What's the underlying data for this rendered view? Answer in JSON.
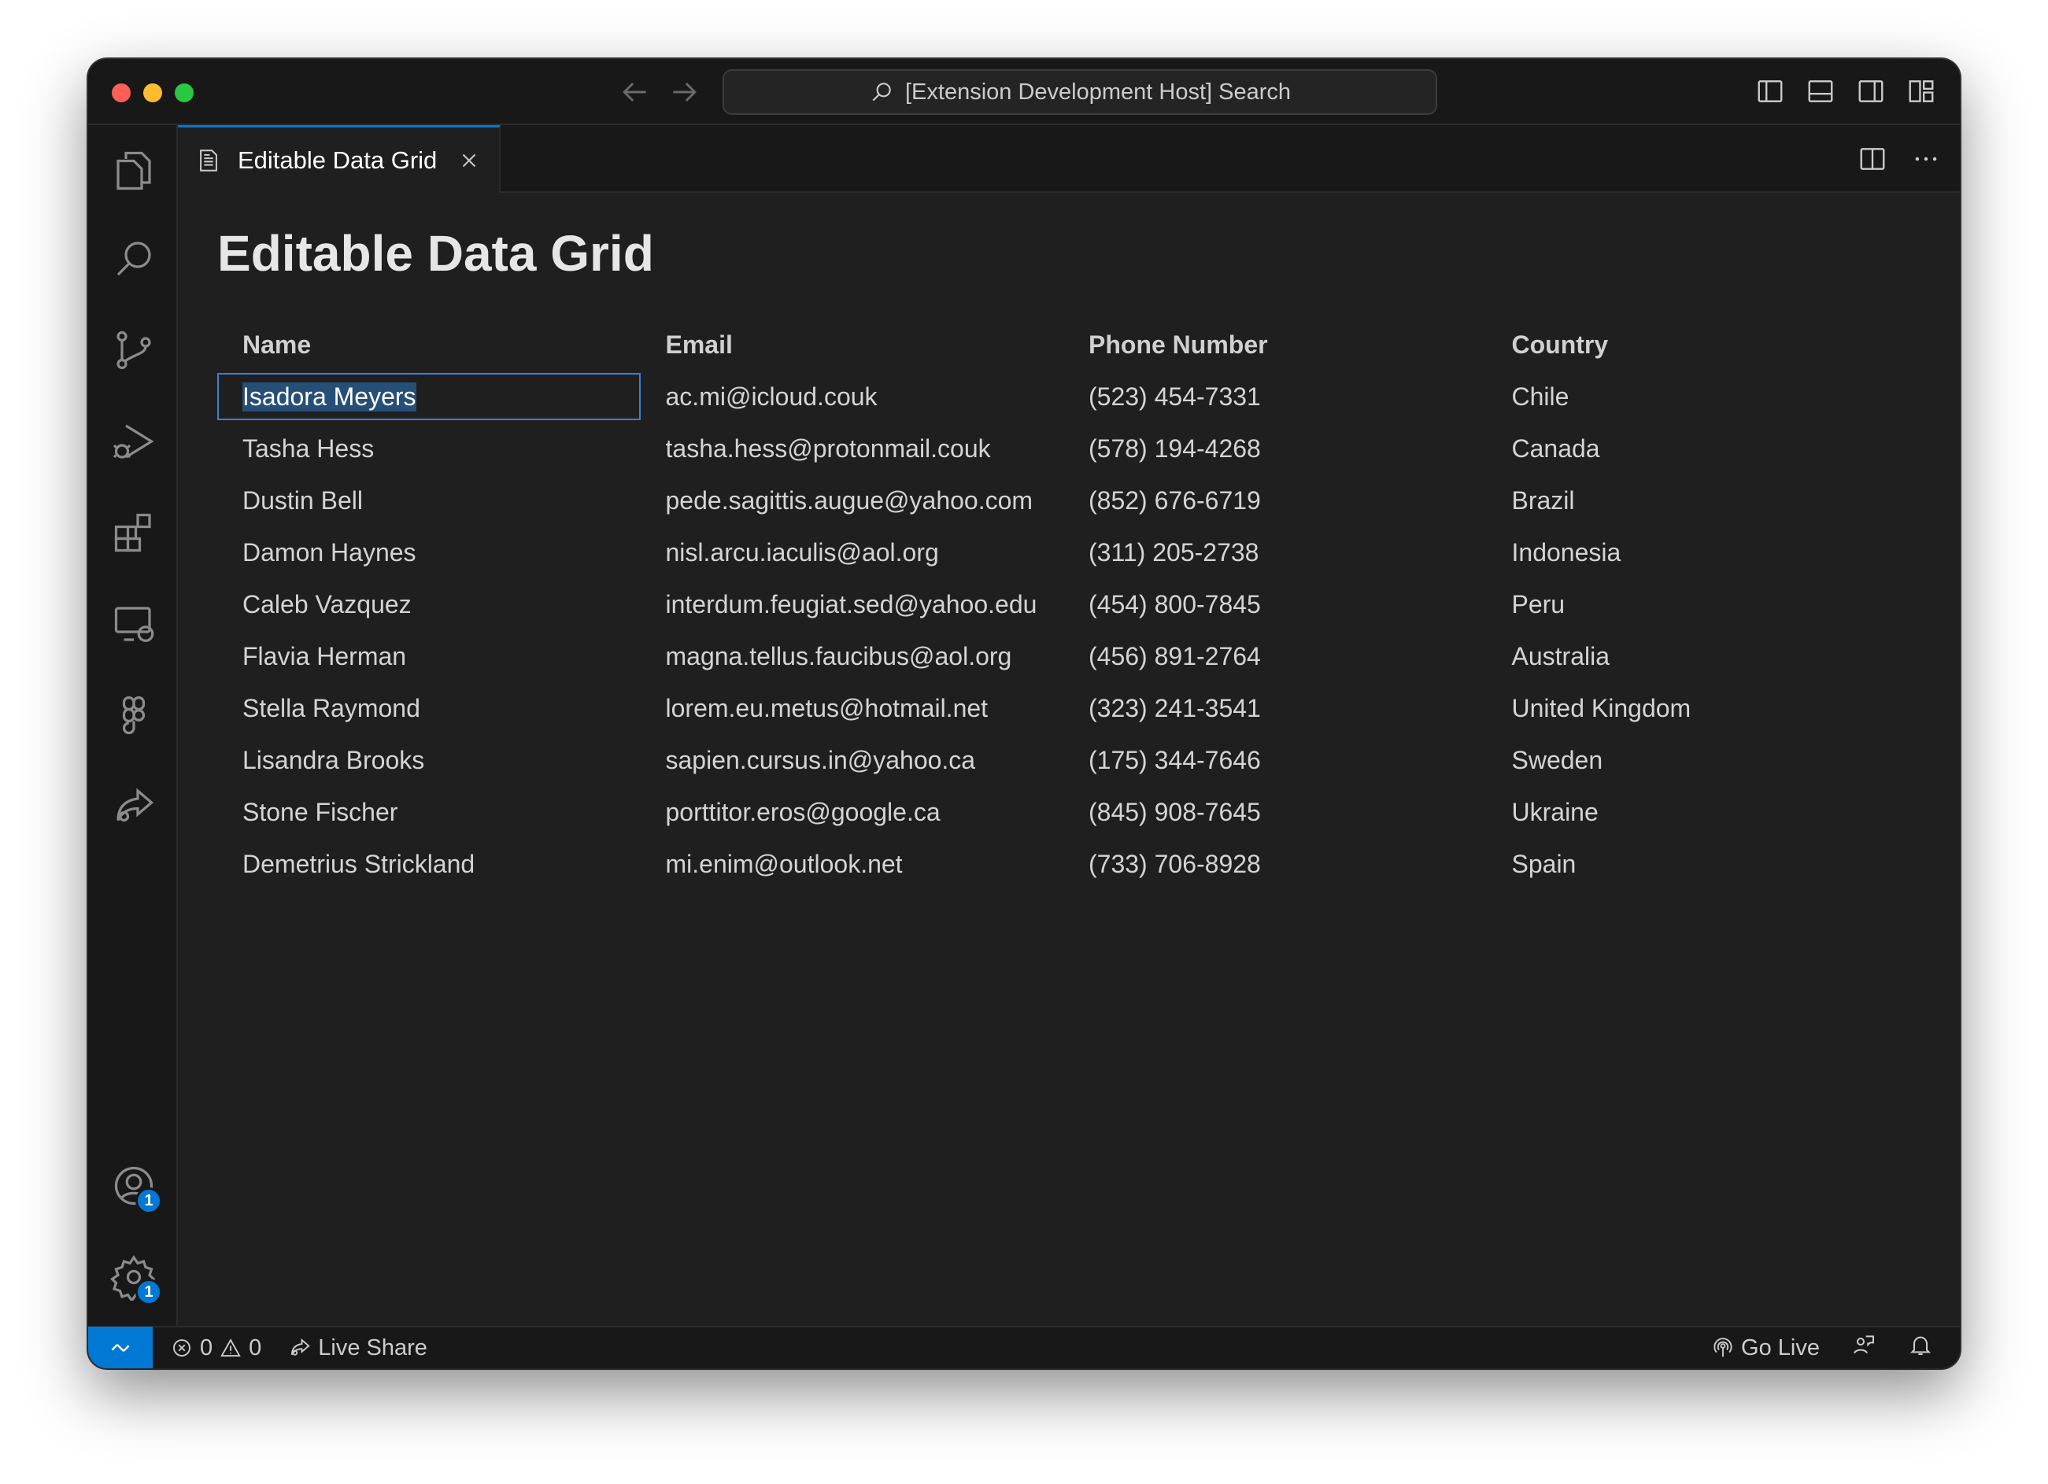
{
  "titlebar": {
    "search_text": "[Extension Development Host] Search"
  },
  "tab": {
    "label": "Editable Data Grid"
  },
  "editor": {
    "title": "Editable Data Grid"
  },
  "grid": {
    "columns": [
      "Name",
      "Email",
      "Phone Number",
      "Country"
    ],
    "rows": [
      [
        "Isadora Meyers",
        "ac.mi@icloud.couk",
        "(523) 454-7331",
        "Chile"
      ],
      [
        "Tasha Hess",
        "tasha.hess@protonmail.couk",
        "(578) 194-4268",
        "Canada"
      ],
      [
        "Dustin Bell",
        "pede.sagittis.augue@yahoo.com",
        "(852) 676-6719",
        "Brazil"
      ],
      [
        "Damon Haynes",
        "nisl.arcu.iaculis@aol.org",
        "(311) 205-2738",
        "Indonesia"
      ],
      [
        "Caleb Vazquez",
        "interdum.feugiat.sed@yahoo.edu",
        "(454) 800-7845",
        "Peru"
      ],
      [
        "Flavia Herman",
        "magna.tellus.faucibus@aol.org",
        "(456) 891-2764",
        "Australia"
      ],
      [
        "Stella Raymond",
        "lorem.eu.metus@hotmail.net",
        "(323) 241-3541",
        "United Kingdom"
      ],
      [
        "Lisandra Brooks",
        "sapien.cursus.in@yahoo.ca",
        "(175) 344-7646",
        "Sweden"
      ],
      [
        "Stone Fischer",
        "porttitor.eros@google.ca",
        "(845) 908-7645",
        "Ukraine"
      ],
      [
        "Demetrius Strickland",
        "mi.enim@outlook.net",
        "(733) 706-8928",
        "Spain"
      ]
    ]
  },
  "activitybar": {
    "accounts_badge": "1",
    "settings_badge": "1"
  },
  "statusbar": {
    "errors": "0",
    "warnings": "0",
    "live_share": "Live Share",
    "go_live": "Go Live"
  },
  "colors": {
    "accent": "#0078d4",
    "background": "#1f1f1f",
    "selection": "#264f78"
  }
}
